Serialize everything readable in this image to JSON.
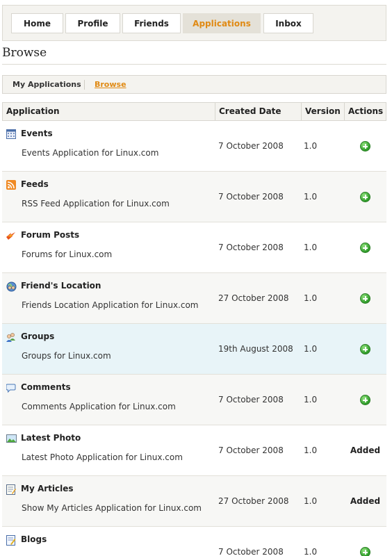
{
  "nav": {
    "tabs": [
      {
        "label": "Home"
      },
      {
        "label": "Profile"
      },
      {
        "label": "Friends"
      },
      {
        "label": "Applications"
      },
      {
        "label": "Inbox"
      }
    ],
    "active_tab": "Applications"
  },
  "page": {
    "title": "Browse"
  },
  "subnav": {
    "my_applications": "My Applications",
    "browse": "Browse"
  },
  "table": {
    "headers": {
      "application": "Application",
      "created_date": "Created Date",
      "version": "Version",
      "actions": "Actions"
    },
    "rows": [
      {
        "icon": "calendar-icon",
        "name": "Events",
        "desc": "Events Application for Linux.com",
        "date": "7 October 2008",
        "version": "1.0",
        "action": "add"
      },
      {
        "icon": "rss-feed-icon",
        "name": "Feeds",
        "desc": "RSS Feed Application for Linux.com",
        "date": "7 October 2008",
        "version": "1.0",
        "action": "add"
      },
      {
        "icon": "forum-posts-icon",
        "name": "Forum Posts",
        "desc": "Forums for Linux.com",
        "date": "7 October 2008",
        "version": "1.0",
        "action": "add"
      },
      {
        "icon": "friend-location-icon",
        "name": "Friend's Location",
        "desc": "Friends Location Application for Linux.com",
        "date": "27 October 2008",
        "version": "1.0",
        "action": "add"
      },
      {
        "icon": "groups-icon",
        "name": "Groups",
        "desc": "Groups for Linux.com",
        "date": "19th August 2008",
        "version": "1.0",
        "action": "add"
      },
      {
        "icon": "comments-icon",
        "name": "Comments",
        "desc": "Comments Application for Linux.com",
        "date": "7 October 2008",
        "version": "1.0",
        "action": "add"
      },
      {
        "icon": "photo-icon",
        "name": "Latest Photo",
        "desc": "Latest Photo Application for Linux.com",
        "date": "7 October 2008",
        "version": "1.0",
        "action": "Added"
      },
      {
        "icon": "articles-icon",
        "name": "My Articles",
        "desc": "Show My Articles Application for Linux.com",
        "date": "27 October 2008",
        "version": "1.0",
        "action": "Added"
      },
      {
        "icon": "blogs-icon",
        "name": "Blogs",
        "desc": "",
        "date": "7 October 2008",
        "version": "1.0",
        "action": "add"
      }
    ]
  },
  "colors": {
    "accent": "#e08a14",
    "highlight_row": "#e8f4f8",
    "add_green": "#2f9b2a"
  }
}
